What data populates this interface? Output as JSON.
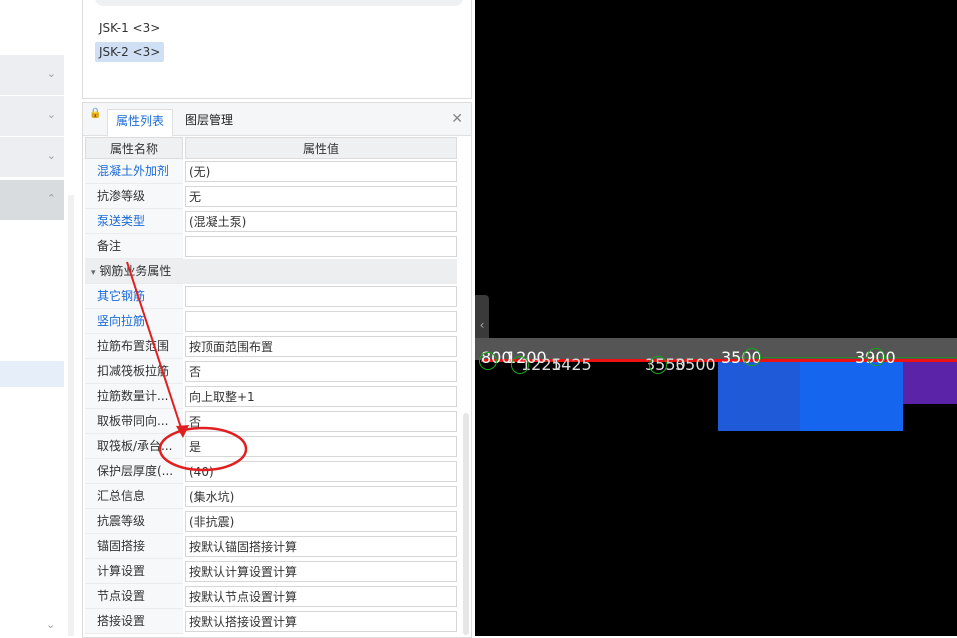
{
  "nav": {
    "items": [
      {
        "chevron": "chevron-down-icon"
      },
      {
        "chevron": "chevron-down-icon"
      },
      {
        "chevron": "chevron-down-icon"
      },
      {
        "chevron": "chevron-up-icon"
      }
    ],
    "bottom_chevron": "chevron-down-icon"
  },
  "list": {
    "items": [
      {
        "label": "JSK-1 <3>",
        "selected": false
      },
      {
        "label": "JSK-2 <3>",
        "selected": true
      }
    ]
  },
  "properties": {
    "tabs": [
      {
        "label": "属性列表",
        "active": true
      },
      {
        "label": "图层管理",
        "active": false
      }
    ],
    "columns": {
      "name": "属性名称",
      "value": "属性值"
    },
    "rows": [
      {
        "name": "混凝土外加剂",
        "value": "(无)",
        "link": true
      },
      {
        "name": "抗渗等级",
        "value": "无",
        "link": false
      },
      {
        "name": "泵送类型",
        "value": "(混凝土泵)",
        "link": true
      },
      {
        "name": "备注",
        "value": "",
        "link": false
      },
      {
        "name": "钢筋业务属性",
        "value": "",
        "group": true
      },
      {
        "name": "其它钢筋",
        "value": "",
        "link": true
      },
      {
        "name": "竖向拉筋",
        "value": "",
        "link": true
      },
      {
        "name": "拉筋布置范围",
        "value": "按顶面范围布置",
        "link": false
      },
      {
        "name": "扣减筏板拉筋",
        "value": "否",
        "link": false
      },
      {
        "name": "拉筋数量计...",
        "value": "向上取整+1",
        "link": false
      },
      {
        "name": "取板带同向...",
        "value": "否",
        "link": false
      },
      {
        "name": "取筏板/承台...",
        "value": "是",
        "link": false
      },
      {
        "name": "保护层厚度(...",
        "value": "(40)",
        "link": false
      },
      {
        "name": "汇总信息",
        "value": "(集水坑)",
        "link": false
      },
      {
        "name": "抗震等级",
        "value": "(非抗震)",
        "link": false
      },
      {
        "name": "锚固搭接",
        "value": "按默认锚固搭接计算",
        "link": false
      },
      {
        "name": "计算设置",
        "value": "按默认计算设置计算",
        "link": false
      },
      {
        "name": "节点设置",
        "value": "按默认节点设置计算",
        "link": false
      },
      {
        "name": "搭接设置",
        "value": "按默认搭接设置计算",
        "link": false
      }
    ]
  },
  "annotation": {
    "color": "#e02020"
  },
  "canvas": {
    "dims": [
      "800",
      "1200",
      "1225",
      "1425",
      "3500",
      "3550",
      "3500",
      "3900"
    ],
    "colors": {
      "background": "#000000",
      "line": "#e11111",
      "block_blue": "#1565ef",
      "block_purple": "#5b24a8"
    }
  }
}
